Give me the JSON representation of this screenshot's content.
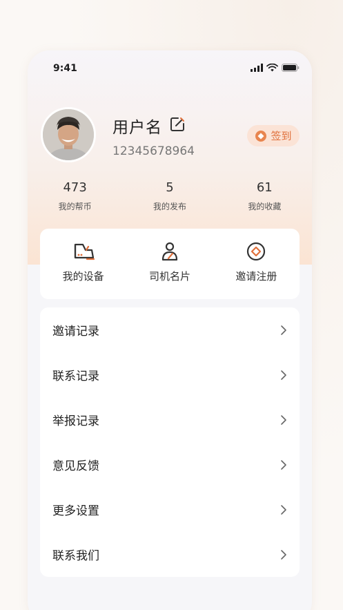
{
  "status_bar": {
    "time": "9:41"
  },
  "profile": {
    "username": "用户名",
    "phone": "12345678964"
  },
  "checkin": {
    "label": "签到"
  },
  "stats": [
    {
      "value": "473",
      "label": "我的帮币"
    },
    {
      "value": "5",
      "label": "我的发布"
    },
    {
      "value": "61",
      "label": "我的收藏"
    }
  ],
  "quick_actions": [
    {
      "label": "我的设备",
      "icon": "device-icon"
    },
    {
      "label": "司机名片",
      "icon": "driver-card-icon"
    },
    {
      "label": "邀请注册",
      "icon": "invite-register-icon"
    }
  ],
  "menu": [
    {
      "label": "邀请记录"
    },
    {
      "label": "联系记录"
    },
    {
      "label": "举报记录"
    },
    {
      "label": "意见反馈"
    },
    {
      "label": "更多设置"
    },
    {
      "label": "联系我们"
    }
  ],
  "colors": {
    "accent": "#e0703c",
    "checkin_bg": "#fbe3d6",
    "icon": "#333333"
  }
}
